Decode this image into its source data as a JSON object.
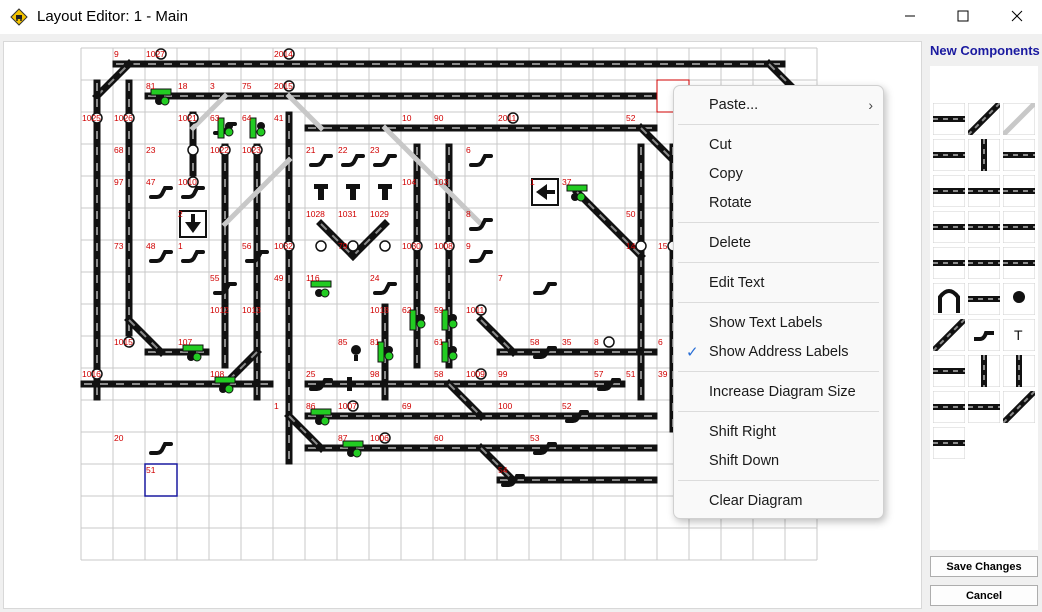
{
  "window": {
    "title": "Layout Editor: 1 - Main"
  },
  "icons": {
    "app": "railway-warning-icon",
    "minimize": "minimize-icon",
    "maximize": "maximize-icon",
    "close": "close-icon"
  },
  "right_panel": {
    "title": "New Components",
    "palette": [
      "straight-track-icon",
      "diagonal-track-icon",
      "diagonal-dashed-track-icon",
      "curve-left-icon",
      "vertical-track-icon",
      "curve-right-icon",
      "signal-track-icon",
      "bumper-track-icon",
      "buffer-stop-icon",
      "crossing-icon",
      "double-crossing-icon",
      "cross-track-icon",
      "turnout-left-icon",
      "turnout-right-icon",
      "block-track-icon",
      "tunnel-icon",
      "platform-icon",
      "lamp-icon",
      "diagonal-curve-icon",
      "turnout-motor-icon",
      "text-icon",
      "arrow-block-icon",
      "vertical-arrow-icon",
      "vertical-curve-icon",
      "v-track-icon",
      "v-double-track-icon",
      "diagonal-end-icon",
      "triangle-block-icon"
    ],
    "save_label": "Save Changes",
    "cancel_label": "Cancel"
  },
  "context_menu": {
    "items": [
      {
        "label": "Paste...",
        "submenu": true
      },
      {
        "label": "Cut"
      },
      {
        "label": "Copy"
      },
      {
        "label": "Rotate"
      },
      {
        "label": "Delete"
      },
      {
        "label": "Edit Text"
      },
      {
        "label": "Show Text Labels"
      },
      {
        "label": "Show Address Labels",
        "checked": true
      },
      {
        "label": "Increase Diagram Size"
      },
      {
        "label": "Shift Right"
      },
      {
        "label": "Shift Down"
      },
      {
        "label": "Clear Diagram"
      }
    ]
  },
  "colors": {
    "track": "#111111",
    "sleeper": "#8c8c8c",
    "label": "#d00000",
    "signal_green": "#22cc22",
    "selection": "#1a1aa0",
    "menu_check": "#2a6fd6"
  },
  "diagram": {
    "labels": [
      {
        "t": "9",
        "c": 1,
        "r": 0
      },
      {
        "t": "1027",
        "c": 2,
        "r": 0
      },
      {
        "t": "2014",
        "c": 6,
        "r": 0
      },
      {
        "t": "81",
        "c": 2,
        "r": 1
      },
      {
        "t": "18",
        "c": 3,
        "r": 1
      },
      {
        "t": "3",
        "c": 4,
        "r": 1
      },
      {
        "t": "75",
        "c": 5,
        "r": 1
      },
      {
        "t": "2015",
        "c": 6,
        "r": 1
      },
      {
        "t": "1025",
        "c": 0,
        "r": 2
      },
      {
        "t": "1026",
        "c": 1,
        "r": 2
      },
      {
        "t": "1021",
        "c": 3,
        "r": 2
      },
      {
        "t": "63",
        "c": 4,
        "r": 2
      },
      {
        "t": "64",
        "c": 5,
        "r": 2
      },
      {
        "t": "41",
        "c": 6,
        "r": 2
      },
      {
        "t": "10",
        "c": 10,
        "r": 2
      },
      {
        "t": "90",
        "c": 11,
        "r": 2
      },
      {
        "t": "2011",
        "c": 13,
        "r": 2
      },
      {
        "t": "52",
        "c": 17,
        "r": 2
      },
      {
        "t": "68",
        "c": 1,
        "r": 3
      },
      {
        "t": "23",
        "c": 2,
        "r": 3
      },
      {
        "t": "1022",
        "c": 4,
        "r": 3
      },
      {
        "t": "1023",
        "c": 5,
        "r": 3
      },
      {
        "t": "21",
        "c": 7,
        "r": 3
      },
      {
        "t": "22",
        "c": 8,
        "r": 3
      },
      {
        "t": "23",
        "c": 9,
        "r": 3
      },
      {
        "t": "6",
        "c": 12,
        "r": 3
      },
      {
        "t": "97",
        "c": 1,
        "r": 4
      },
      {
        "t": "47",
        "c": 2,
        "r": 4
      },
      {
        "t": "1010",
        "c": 3,
        "r": 4
      },
      {
        "t": "104",
        "c": 10,
        "r": 4
      },
      {
        "t": "103",
        "c": 11,
        "r": 4
      },
      {
        "t": "1",
        "c": 14,
        "r": 4
      },
      {
        "t": "37",
        "c": 15,
        "r": 4
      },
      {
        "t": "2",
        "c": 3,
        "r": 5
      },
      {
        "t": "1028",
        "c": 7,
        "r": 5
      },
      {
        "t": "1031",
        "c": 8,
        "r": 5
      },
      {
        "t": "1029",
        "c": 9,
        "r": 5
      },
      {
        "t": "8",
        "c": 12,
        "r": 5
      },
      {
        "t": "50",
        "c": 17,
        "r": 5
      },
      {
        "t": "73",
        "c": 1,
        "r": 6
      },
      {
        "t": "48",
        "c": 2,
        "r": 6
      },
      {
        "t": "1",
        "c": 3,
        "r": 6
      },
      {
        "t": "56",
        "c": 5,
        "r": 6
      },
      {
        "t": "1032",
        "c": 6,
        "r": 6
      },
      {
        "t": "79",
        "c": 8,
        "r": 6
      },
      {
        "t": "1030",
        "c": 10,
        "r": 6
      },
      {
        "t": "1008",
        "c": 11,
        "r": 6
      },
      {
        "t": "9",
        "c": 12,
        "r": 6
      },
      {
        "t": "14",
        "c": 17,
        "r": 6
      },
      {
        "t": "15",
        "c": 18,
        "r": 6
      },
      {
        "t": "55",
        "c": 4,
        "r": 7
      },
      {
        "t": "49",
        "c": 6,
        "r": 7
      },
      {
        "t": "116",
        "c": 7,
        "r": 7
      },
      {
        "t": "24",
        "c": 9,
        "r": 7
      },
      {
        "t": "7",
        "c": 13,
        "r": 7
      },
      {
        "t": "1012",
        "c": 4,
        "r": 8
      },
      {
        "t": "1013",
        "c": 5,
        "r": 8
      },
      {
        "t": "1018",
        "c": 9,
        "r": 8
      },
      {
        "t": "62",
        "c": 10,
        "r": 8
      },
      {
        "t": "59",
        "c": 11,
        "r": 8
      },
      {
        "t": "1011",
        "c": 12,
        "r": 8
      },
      {
        "t": "1015",
        "c": 1,
        "r": 9
      },
      {
        "t": "107",
        "c": 3,
        "r": 9
      },
      {
        "t": "85",
        "c": 8,
        "r": 9
      },
      {
        "t": "81",
        "c": 9,
        "r": 9
      },
      {
        "t": "61",
        "c": 11,
        "r": 9
      },
      {
        "t": "58",
        "c": 14,
        "r": 9
      },
      {
        "t": "35",
        "c": 15,
        "r": 9
      },
      {
        "t": "8",
        "c": 16,
        "r": 9
      },
      {
        "t": "6",
        "c": 18,
        "r": 9
      },
      {
        "t": "1016",
        "c": 0,
        "r": 10
      },
      {
        "t": "108",
        "c": 4,
        "r": 10
      },
      {
        "t": "25",
        "c": 7,
        "r": 10
      },
      {
        "t": "98",
        "c": 9,
        "r": 10
      },
      {
        "t": "58",
        "c": 11,
        "r": 10
      },
      {
        "t": "1009",
        "c": 12,
        "r": 10
      },
      {
        "t": "99",
        "c": 13,
        "r": 10
      },
      {
        "t": "57",
        "c": 16,
        "r": 10
      },
      {
        "t": "51",
        "c": 17,
        "r": 10
      },
      {
        "t": "39",
        "c": 18,
        "r": 10
      },
      {
        "t": "1",
        "c": 6,
        "r": 11
      },
      {
        "t": "86",
        "c": 7,
        "r": 11
      },
      {
        "t": "1007",
        "c": 8,
        "r": 11
      },
      {
        "t": "69",
        "c": 10,
        "r": 11
      },
      {
        "t": "100",
        "c": 13,
        "r": 11
      },
      {
        "t": "52",
        "c": 15,
        "r": 11
      },
      {
        "t": "20",
        "c": 1,
        "r": 12
      },
      {
        "t": "87",
        "c": 8,
        "r": 12
      },
      {
        "t": "1006",
        "c": 9,
        "r": 12
      },
      {
        "t": "60",
        "c": 11,
        "r": 12
      },
      {
        "t": "53",
        "c": 14,
        "r": 12
      },
      {
        "t": "51",
        "c": 2,
        "r": 13
      },
      {
        "t": "54",
        "c": 13,
        "r": 13
      }
    ]
  }
}
